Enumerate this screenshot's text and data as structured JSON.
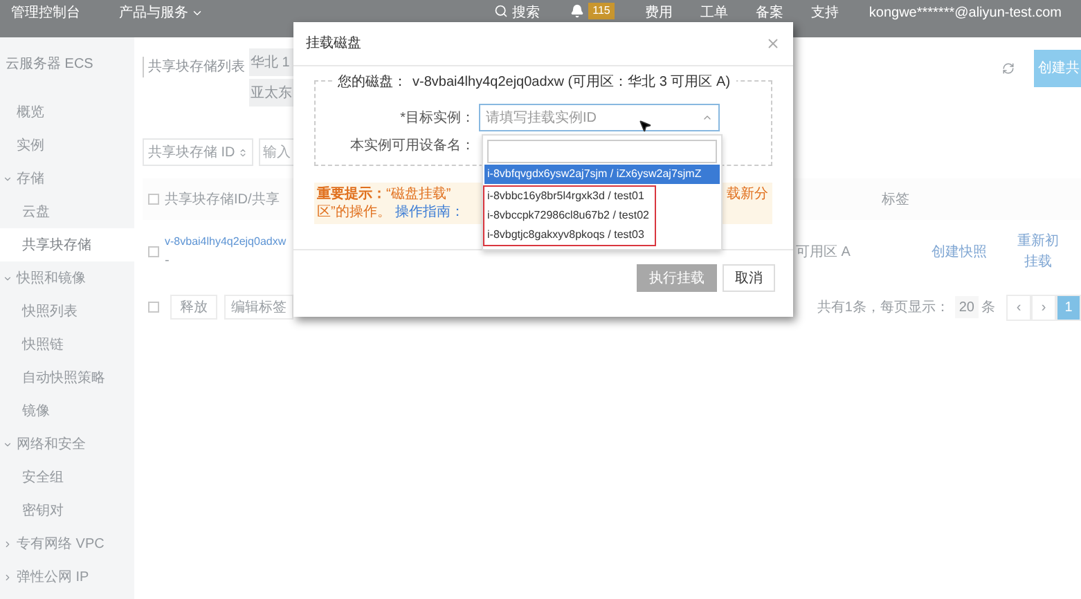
{
  "top_nav": {
    "console": "管理控制台",
    "products": "产品与服务",
    "search": "搜索",
    "notification_count": "115",
    "links": [
      "费用",
      "工单",
      "备案",
      "支持"
    ],
    "user": "kongwe*******@aliyun-test.com"
  },
  "sidebar": {
    "title": "云服务器 ECS",
    "items": [
      {
        "label": "概览",
        "selected": false
      },
      {
        "label": "实例",
        "selected": false
      },
      {
        "label": "存储",
        "selected": false,
        "expanded": true,
        "children": [
          {
            "label": "云盘",
            "selected": false
          },
          {
            "label": "共享块存储",
            "selected": true
          }
        ]
      },
      {
        "label": "快照和镜像",
        "selected": false,
        "expanded": true,
        "children": [
          {
            "label": "快照列表",
            "selected": false
          },
          {
            "label": "快照链",
            "selected": false
          },
          {
            "label": "自动快照策略",
            "selected": false
          },
          {
            "label": "镜像",
            "selected": false
          }
        ]
      },
      {
        "label": "网络和安全",
        "selected": false,
        "expanded": true,
        "children": [
          {
            "label": "安全组",
            "selected": false
          },
          {
            "label": "密钥对",
            "selected": false
          }
        ]
      },
      {
        "label": "专有网络 VPC",
        "selected": false,
        "expanded": false
      },
      {
        "label": "弹性公网 IP",
        "selected": false,
        "expanded": false
      }
    ]
  },
  "page": {
    "title": "共享块存储列表",
    "regions": [
      {
        "label": "华北 1",
        "selected": false
      },
      {
        "label": "亚太东",
        "selected": false
      }
    ],
    "create_button": "创建共",
    "filter": {
      "field": "共享块存储 ID",
      "placeholder": "输入"
    },
    "table": {
      "select_all_checked": false,
      "columns": [
        "共享块存储ID/共享",
        "标签"
      ],
      "rows": [
        {
          "id": "v-8vbai4lhy4q2ejq0adxw",
          "name": "-",
          "zone": "可用区 A",
          "actions": [
            "创建快照",
            "重新初",
            "挂载"
          ],
          "checked": false
        }
      ]
    },
    "footer": {
      "select_all_checked": false,
      "buttons": [
        "释放",
        "编辑标签"
      ],
      "total": "共有1条，每页显示：",
      "page_size": "20",
      "unit": "条",
      "pages": [
        {
          "label": "‹",
          "selected": false
        },
        {
          "label": "›",
          "selected": false
        },
        {
          "label": "1",
          "selected": true
        }
      ]
    }
  },
  "dialog": {
    "title": "挂载磁盘",
    "disk_label": "您的磁盘：",
    "disk": "v-8vbai4lhy4q2ejq0adxw (可用区：华北 3 可用区 A)",
    "target_label": "*目标实例：",
    "target_placeholder": "请填写挂载实例ID",
    "device_label": "本实例可用设备名：",
    "tip": {
      "lead": "重要提示：",
      "text": "“磁盘挂载”",
      "tail": "载新分",
      "line2": "区”的操作。",
      "link": "操作指南："
    },
    "dropdown": {
      "options": [
        {
          "label": "i-8vbfqvgdx6ysw2aj7sjm / iZx6ysw2aj7sjmZ",
          "selected": true,
          "highlighted": false
        },
        {
          "label": "i-8vbbc16y8br5l4rgxk3d / test01",
          "selected": false,
          "highlighted": true
        },
        {
          "label": "i-8vbccpk72986cl8u67b2 / test02",
          "selected": false,
          "highlighted": true
        },
        {
          "label": "i-8vbgtjc8gakxyv8pkoqs / test03",
          "selected": false,
          "highlighted": true
        }
      ]
    },
    "buttons": [
      {
        "label": "执行挂载",
        "disabled": true
      },
      {
        "label": "取消",
        "disabled": false
      }
    ]
  }
}
